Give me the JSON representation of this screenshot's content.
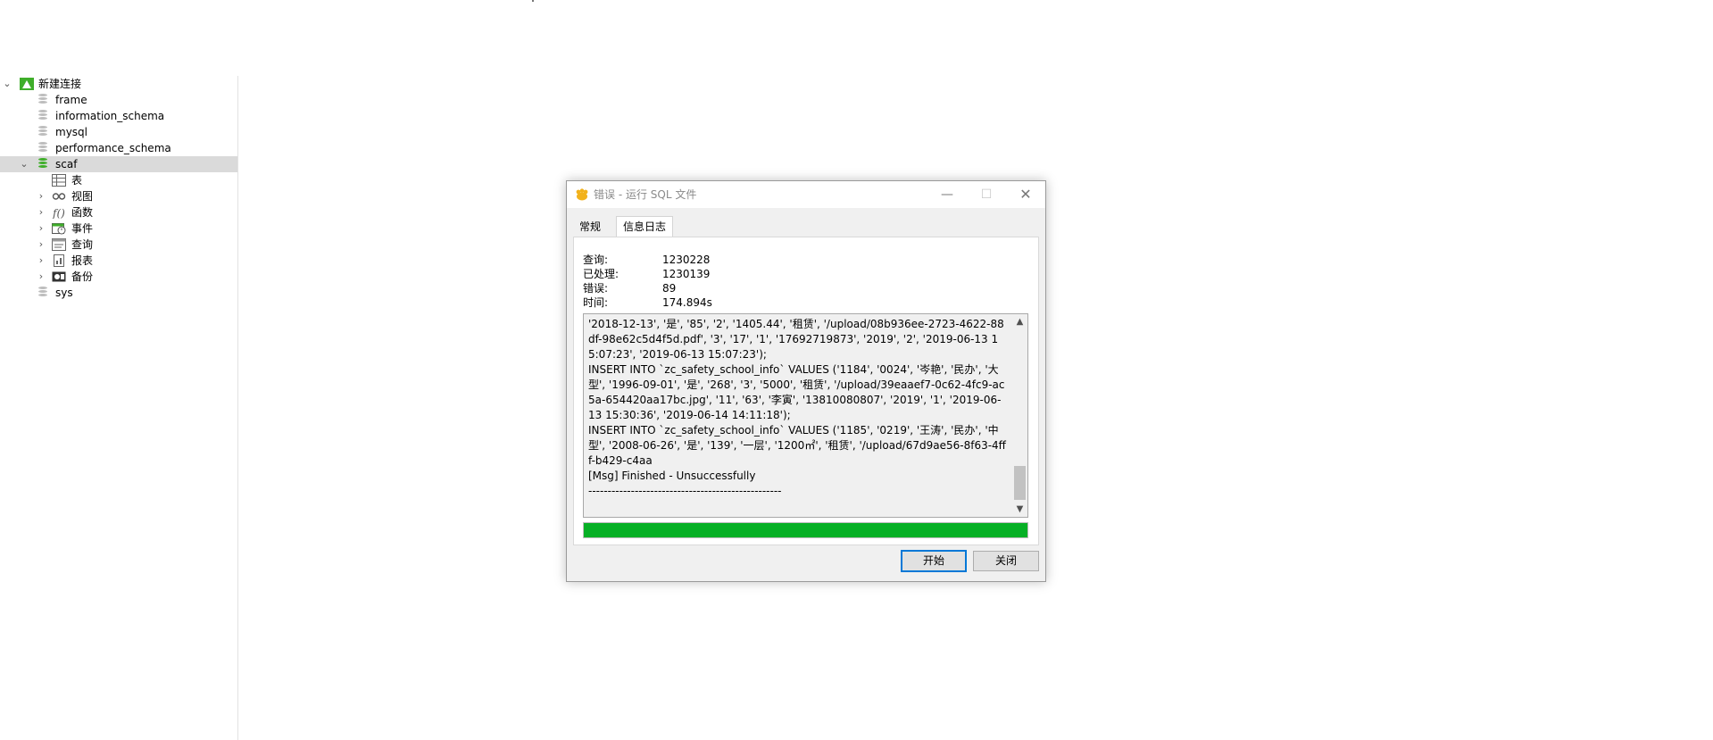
{
  "tree": {
    "connection": "新建连接",
    "databases_before": [
      "frame",
      "information_schema",
      "mysql",
      "performance_schema"
    ],
    "active_db": "scaf",
    "children": [
      {
        "label": "表",
        "icon": "table-icon",
        "expandable": false
      },
      {
        "label": "视图",
        "icon": "view-icon",
        "expandable": true
      },
      {
        "label": "函数",
        "icon": "function-icon",
        "expandable": true
      },
      {
        "label": "事件",
        "icon": "event-icon",
        "expandable": true
      },
      {
        "label": "查询",
        "icon": "query-icon",
        "expandable": true
      },
      {
        "label": "报表",
        "icon": "report-icon",
        "expandable": true
      },
      {
        "label": "备份",
        "icon": "backup-icon",
        "expandable": true
      }
    ],
    "databases_after": [
      "sys"
    ]
  },
  "dialog": {
    "title": "错误 - 运行 SQL 文件",
    "window_controls": {
      "minimize": "—",
      "maximize": "☐",
      "close": "✕"
    },
    "tabs": [
      "常规",
      "信息日志"
    ],
    "active_tab": "信息日志",
    "stats": [
      {
        "label": "查询:",
        "value": "1230228"
      },
      {
        "label": "已处理:",
        "value": "1230139"
      },
      {
        "label": "错误:",
        "value": "89"
      },
      {
        "label": "时间:",
        "value": "174.894s"
      }
    ],
    "log": "'2018-12-13', '是', '85', '2', '1405.44', '租赁', '/upload/08b936ee-2723-4622-88df-98e62c5d4f5d.pdf', '3', '17', '1', '17692719873', '2019', '2', '2019-06-13 15:07:23', '2019-06-13 15:07:23');\nINSERT INTO `zc_safety_school_info` VALUES ('1184', '0024', '岑艳', '民办', '大型', '1996-09-01', '是', '268', '3', '5000', '租赁', '/upload/39eaaef7-0c62-4fc9-ac5a-654420aa17bc.jpg', '11', '63', '李寅', '13810080807', '2019', '1', '2019-06-13 15:30:36', '2019-06-14 14:11:18');\nINSERT INTO `zc_safety_school_info` VALUES ('1185', '0219', '王涛', '民办', '中型', '2008-06-26', '是', '139', '一层', '1200㎡', '租赁', '/upload/67d9ae56-8f63-4fff-b429-c4aa\n[Msg] Finished - Unsuccessfully\n--------------------------------------------------",
    "progress": 1.0,
    "progress_color": "#06b025",
    "buttons": {
      "start": "开始",
      "close": "关闭"
    }
  }
}
